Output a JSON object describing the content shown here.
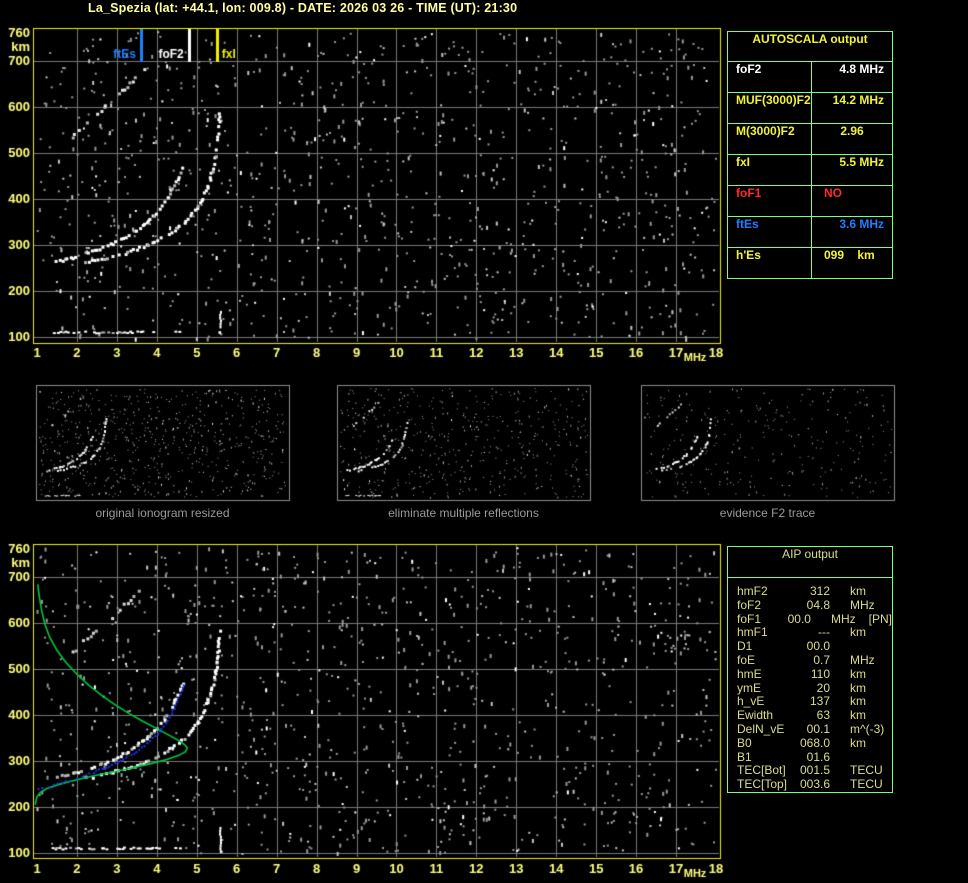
{
  "title": "La_Spezia (lat: +44.1, lon: 009.8) - DATE: 2026 03 26 - TIME (UT): 21:30",
  "colors": {
    "yellow": "#F2F238",
    "pale_yellow": "#FFFF7F",
    "white": "#FFFFFF",
    "red": "#FF2A2A",
    "blue": "#1F7FFF",
    "green_profile": "#00C840",
    "blue_trace": "#2233FF",
    "table_border": "#7DFF7D",
    "plot_border": "#F0F000",
    "grid": "#787878",
    "aip_text": "#DBDB8D",
    "caption": "#9A9A9A"
  },
  "autoscala_table": {
    "title": "AUTOSCALA output",
    "rows": [
      {
        "label": "foF2",
        "value": "4.8 MHz",
        "color": "white",
        "align": "right"
      },
      {
        "label": "MUF(3000)F2",
        "value": "14.2 MHz",
        "color": "yellow",
        "align": "right"
      },
      {
        "label": "M(3000)F2",
        "value": "2.96",
        "color": "yellow",
        "align": "center"
      },
      {
        "label": "fxI",
        "value": "5.5 MHz",
        "color": "yellow",
        "align": "right"
      },
      {
        "label": "foF1",
        "value": "NO",
        "color": "red",
        "align": "left"
      },
      {
        "label": "ftEs",
        "value": "3.6 MHz",
        "color": "blue",
        "align": "right"
      },
      {
        "label": "h'Es",
        "value": "099    km",
        "color": "yellow",
        "align": "left"
      }
    ]
  },
  "aip_table": {
    "title": "AIP output",
    "rows": [
      {
        "name": "hmF2",
        "value": "312",
        "unit": "km",
        "extra": ""
      },
      {
        "name": "foF2",
        "value": "04.8",
        "unit": "MHz",
        "extra": ""
      },
      {
        "name": "foF1",
        "value": "00.0",
        "unit": "MHz",
        "extra": "[PN]"
      },
      {
        "name": "hmF1",
        "value": "---",
        "unit": "km",
        "extra": ""
      },
      {
        "name": "D1",
        "value": "00.0",
        "unit": "",
        "extra": ""
      },
      {
        "name": "foE",
        "value": "0.7",
        "unit": "MHz",
        "extra": ""
      },
      {
        "name": "hmE",
        "value": "110",
        "unit": "km",
        "extra": ""
      },
      {
        "name": "ymE",
        "value": "20",
        "unit": "km",
        "extra": ""
      },
      {
        "name": "h_vE",
        "value": "137",
        "unit": "km",
        "extra": ""
      },
      {
        "name": "Ewidth",
        "value": "63",
        "unit": "km",
        "extra": ""
      },
      {
        "name": "DelN_vE",
        "value": "00.1",
        "unit": "m^(-3)",
        "extra": ""
      },
      {
        "name": "B0",
        "value": "068.0",
        "unit": "km",
        "extra": ""
      },
      {
        "name": "B1",
        "value": "01.6",
        "unit": "",
        "extra": ""
      },
      {
        "name": "TEC[Bot]",
        "value": "001.5",
        "unit": "TECU",
        "extra": ""
      },
      {
        "name": "TEC[Top]",
        "value": "003.6",
        "unit": "TECU",
        "extra": ""
      }
    ]
  },
  "panels": [
    {
      "caption": "original ionogram resized"
    },
    {
      "caption": "eliminate multiple reflections"
    },
    {
      "caption": "evidence F2 trace"
    }
  ],
  "chart_data": [
    {
      "type": "scatter",
      "title": "scaled ionogram with AUTOSCALA markers",
      "xlabel": "MHz",
      "ylabel": "km",
      "x_range": [
        1,
        18
      ],
      "y_range": [
        100,
        760
      ],
      "x_ticks": [
        1,
        2,
        3,
        4,
        5,
        6,
        7,
        8,
        9,
        10,
        11,
        12,
        13,
        14,
        15,
        16,
        17,
        18
      ],
      "y_ticks": [
        760,
        700,
        600,
        500,
        400,
        300,
        200,
        100
      ],
      "grid": true,
      "markers": [
        {
          "label": "ftEs",
          "f": 3.6,
          "color": "#1F7FFF",
          "side": "left"
        },
        {
          "label": "foF2",
          "f": 4.8,
          "color": "#FFFFFF",
          "side": "left"
        },
        {
          "label": "fxI",
          "f": 5.5,
          "color": "#F0F000",
          "side": "right"
        }
      ],
      "series": [
        {
          "name": "f2-ordinary-trace",
          "color": "#FFFFFF",
          "points": [
            [
              1.45,
              266
            ],
            [
              1.6,
              270
            ],
            [
              1.8,
              274
            ],
            [
              2.0,
              279
            ],
            [
              2.2,
              284
            ],
            [
              2.4,
              290
            ],
            [
              2.6,
              296
            ],
            [
              2.8,
              303
            ],
            [
              3.0,
              311
            ],
            [
              3.2,
              320
            ],
            [
              3.4,
              331
            ],
            [
              3.6,
              344
            ],
            [
              3.8,
              359
            ],
            [
              4.0,
              377
            ],
            [
              4.15,
              394
            ],
            [
              4.3,
              414
            ],
            [
              4.45,
              438
            ],
            [
              4.55,
              458
            ],
            [
              4.65,
              478
            ]
          ]
        },
        {
          "name": "f2-extraordinary-trace",
          "color": "#FFFFFF",
          "points": [
            [
              2.2,
              265
            ],
            [
              2.5,
              270
            ],
            [
              2.8,
              276
            ],
            [
              3.1,
              283
            ],
            [
              3.4,
              291
            ],
            [
              3.7,
              301
            ],
            [
              4.0,
              313
            ],
            [
              4.3,
              328
            ],
            [
              4.6,
              347
            ],
            [
              4.85,
              369
            ],
            [
              5.05,
              393
            ],
            [
              5.2,
              420
            ],
            [
              5.32,
              450
            ],
            [
              5.42,
              484
            ],
            [
              5.48,
              520
            ],
            [
              5.52,
              556
            ],
            [
              5.55,
              592
            ]
          ]
        },
        {
          "name": "second-hop-trace",
          "color": "#E8E8E8",
          "points": [
            [
              1.85,
              538
            ],
            [
              2.0,
              550
            ],
            [
              2.15,
              562
            ],
            [
              2.3,
              574
            ],
            [
              2.5,
              589
            ],
            [
              2.7,
              604
            ],
            [
              2.9,
              620
            ],
            [
              3.1,
              636
            ],
            [
              3.3,
              652
            ],
            [
              3.45,
              666
            ],
            [
              3.6,
              679
            ],
            [
              3.7,
              690
            ]
          ]
        },
        {
          "name": "es-layer",
          "color": "#FFFFFF",
          "h": 112,
          "f_from": 1.35,
          "f_to": 3.95
        },
        {
          "name": "vertical-echo",
          "color": "#FFFFFF",
          "f": 5.57,
          "h_from": 100,
          "h_to": 163
        }
      ]
    },
    {
      "type": "scatter",
      "title": "ionogram with restored trace and electron density profile",
      "xlabel": "MHz",
      "ylabel": "km",
      "x_range": [
        1,
        18
      ],
      "y_range": [
        100,
        760
      ],
      "x_ticks": [
        1,
        2,
        3,
        4,
        5,
        6,
        7,
        8,
        9,
        10,
        11,
        12,
        13,
        14,
        15,
        16,
        17,
        18
      ],
      "y_ticks": [
        760,
        700,
        600,
        500,
        400,
        300,
        200,
        100
      ],
      "grid": true,
      "markers": [],
      "series": [
        {
          "name": "f2-ordinary-trace",
          "color": "#FFFFFF",
          "points": [
            [
              1.45,
              266
            ],
            [
              1.6,
              270
            ],
            [
              1.8,
              274
            ],
            [
              2.0,
              279
            ],
            [
              2.2,
              284
            ],
            [
              2.4,
              290
            ],
            [
              2.6,
              296
            ],
            [
              2.8,
              303
            ],
            [
              3.0,
              311
            ],
            [
              3.2,
              320
            ],
            [
              3.4,
              331
            ],
            [
              3.6,
              344
            ],
            [
              3.8,
              359
            ],
            [
              4.0,
              377
            ],
            [
              4.15,
              394
            ],
            [
              4.3,
              414
            ],
            [
              4.45,
              438
            ],
            [
              4.55,
              458
            ],
            [
              4.65,
              478
            ]
          ]
        },
        {
          "name": "f2-extraordinary-trace",
          "color": "#FFFFFF",
          "points": [
            [
              2.2,
              265
            ],
            [
              2.5,
              270
            ],
            [
              2.8,
              276
            ],
            [
              3.1,
              283
            ],
            [
              3.4,
              291
            ],
            [
              3.7,
              301
            ],
            [
              4.0,
              313
            ],
            [
              4.3,
              328
            ],
            [
              4.6,
              347
            ],
            [
              4.85,
              369
            ],
            [
              5.05,
              393
            ],
            [
              5.2,
              420
            ],
            [
              5.32,
              450
            ],
            [
              5.42,
              484
            ],
            [
              5.48,
              520
            ],
            [
              5.52,
              556
            ],
            [
              5.55,
              592
            ]
          ]
        },
        {
          "name": "second-hop-trace",
          "color": "#D8D8D8",
          "points": [
            [
              1.85,
              538
            ],
            [
              2.0,
              550
            ],
            [
              2.15,
              562
            ],
            [
              2.3,
              574
            ],
            [
              2.5,
              589
            ],
            [
              2.7,
              604
            ],
            [
              2.9,
              620
            ],
            [
              3.1,
              636
            ],
            [
              3.3,
              652
            ],
            [
              3.45,
              666
            ],
            [
              3.6,
              679
            ],
            [
              3.7,
              690
            ]
          ]
        },
        {
          "name": "es-layer",
          "color": "#FFFFFF",
          "h": 112,
          "f_from": 1.35,
          "f_to": 3.95
        },
        {
          "name": "vertical-echo",
          "color": "#FFFFFF",
          "f": 5.57,
          "h_from": 100,
          "h_to": 163
        },
        {
          "name": "electron-density-profile",
          "color": "#00C840",
          "points": [
            [
              1.02,
              683
            ],
            [
              1.06,
              655
            ],
            [
              1.12,
              625
            ],
            [
              1.2,
              596
            ],
            [
              1.32,
              568
            ],
            [
              1.5,
              540
            ],
            [
              1.72,
              514
            ],
            [
              2.0,
              488
            ],
            [
              2.3,
              464
            ],
            [
              2.62,
              442
            ],
            [
              2.95,
              422
            ],
            [
              3.3,
              403
            ],
            [
              3.65,
              386
            ],
            [
              4.0,
              370
            ],
            [
              4.3,
              356
            ],
            [
              4.55,
              344
            ],
            [
              4.7,
              335
            ],
            [
              4.76,
              328
            ],
            [
              4.72,
              320
            ],
            [
              4.55,
              312
            ],
            [
              4.25,
              303
            ],
            [
              3.85,
              294
            ],
            [
              3.4,
              285
            ],
            [
              2.9,
              276
            ],
            [
              2.4,
              267
            ],
            [
              1.95,
              258
            ],
            [
              1.55,
              249
            ],
            [
              1.25,
              240
            ],
            [
              1.08,
              231
            ],
            [
              1.0,
              222
            ],
            [
              0.97,
              212
            ],
            [
              0.96,
              205
            ]
          ]
        },
        {
          "name": "restored-trace",
          "color": "#2233FF",
          "points": [
            [
              1.0,
              240
            ],
            [
              1.2,
              244
            ],
            [
              1.4,
              249
            ],
            [
              1.6,
              254
            ],
            [
              1.8,
              259
            ],
            [
              2.0,
              265
            ],
            [
              2.2,
              271
            ],
            [
              2.4,
              277
            ],
            [
              2.6,
              284
            ],
            [
              2.8,
              291
            ],
            [
              3.0,
              299
            ],
            [
              3.2,
              308
            ],
            [
              3.4,
              318
            ],
            [
              3.6,
              330
            ],
            [
              3.8,
              344
            ],
            [
              3.95,
              357
            ],
            [
              4.1,
              371
            ],
            [
              4.25,
              388
            ],
            [
              4.35,
              404
            ],
            [
              4.45,
              422
            ],
            [
              4.52,
              438
            ],
            [
              4.6,
              455
            ],
            [
              4.66,
              468
            ],
            [
              4.7,
              478
            ]
          ]
        }
      ]
    }
  ]
}
